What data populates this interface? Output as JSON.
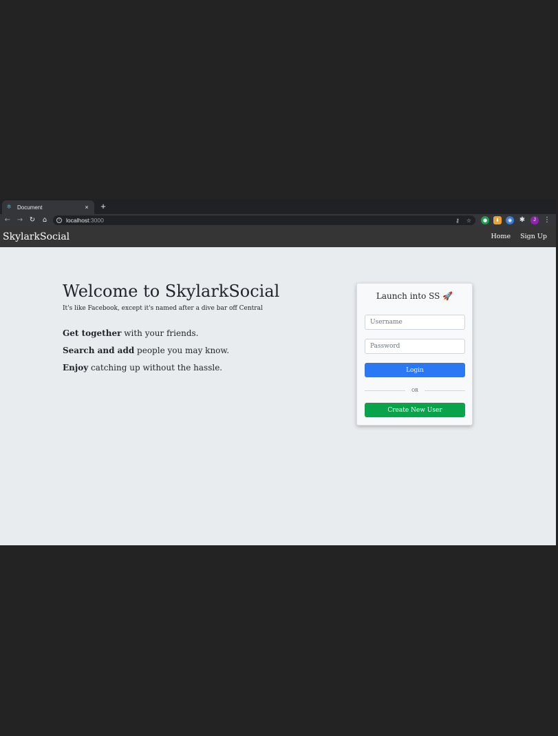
{
  "browser": {
    "tab_title": "Document",
    "tab_close": "×",
    "new_tab": "+",
    "url_host": "localhost",
    "url_port": ":3000",
    "avatar_letter": "J"
  },
  "navbar": {
    "brand": "SkylarkSocial",
    "links": [
      "Home",
      "Sign Up"
    ]
  },
  "hero": {
    "title": "Welcome to SkylarkSocial",
    "subtitle": "It's like Facebook, except it's named after a dive bar off Central",
    "features": [
      {
        "bold": "Get together",
        "rest": " with your friends."
      },
      {
        "bold": "Search and add",
        "rest": " people you may know."
      },
      {
        "bold": "Enjoy",
        "rest": " catching up without the hassle."
      }
    ]
  },
  "login": {
    "title": "Launch into SS 🚀",
    "username_placeholder": "Username",
    "password_placeholder": "Password",
    "login_label": "Login",
    "divider_label": "OR",
    "create_label": "Create New User"
  },
  "colors": {
    "primary": "#2a78f3",
    "success": "#08a34a",
    "navbar": "#353535",
    "page_bg": "#e9ecef"
  }
}
